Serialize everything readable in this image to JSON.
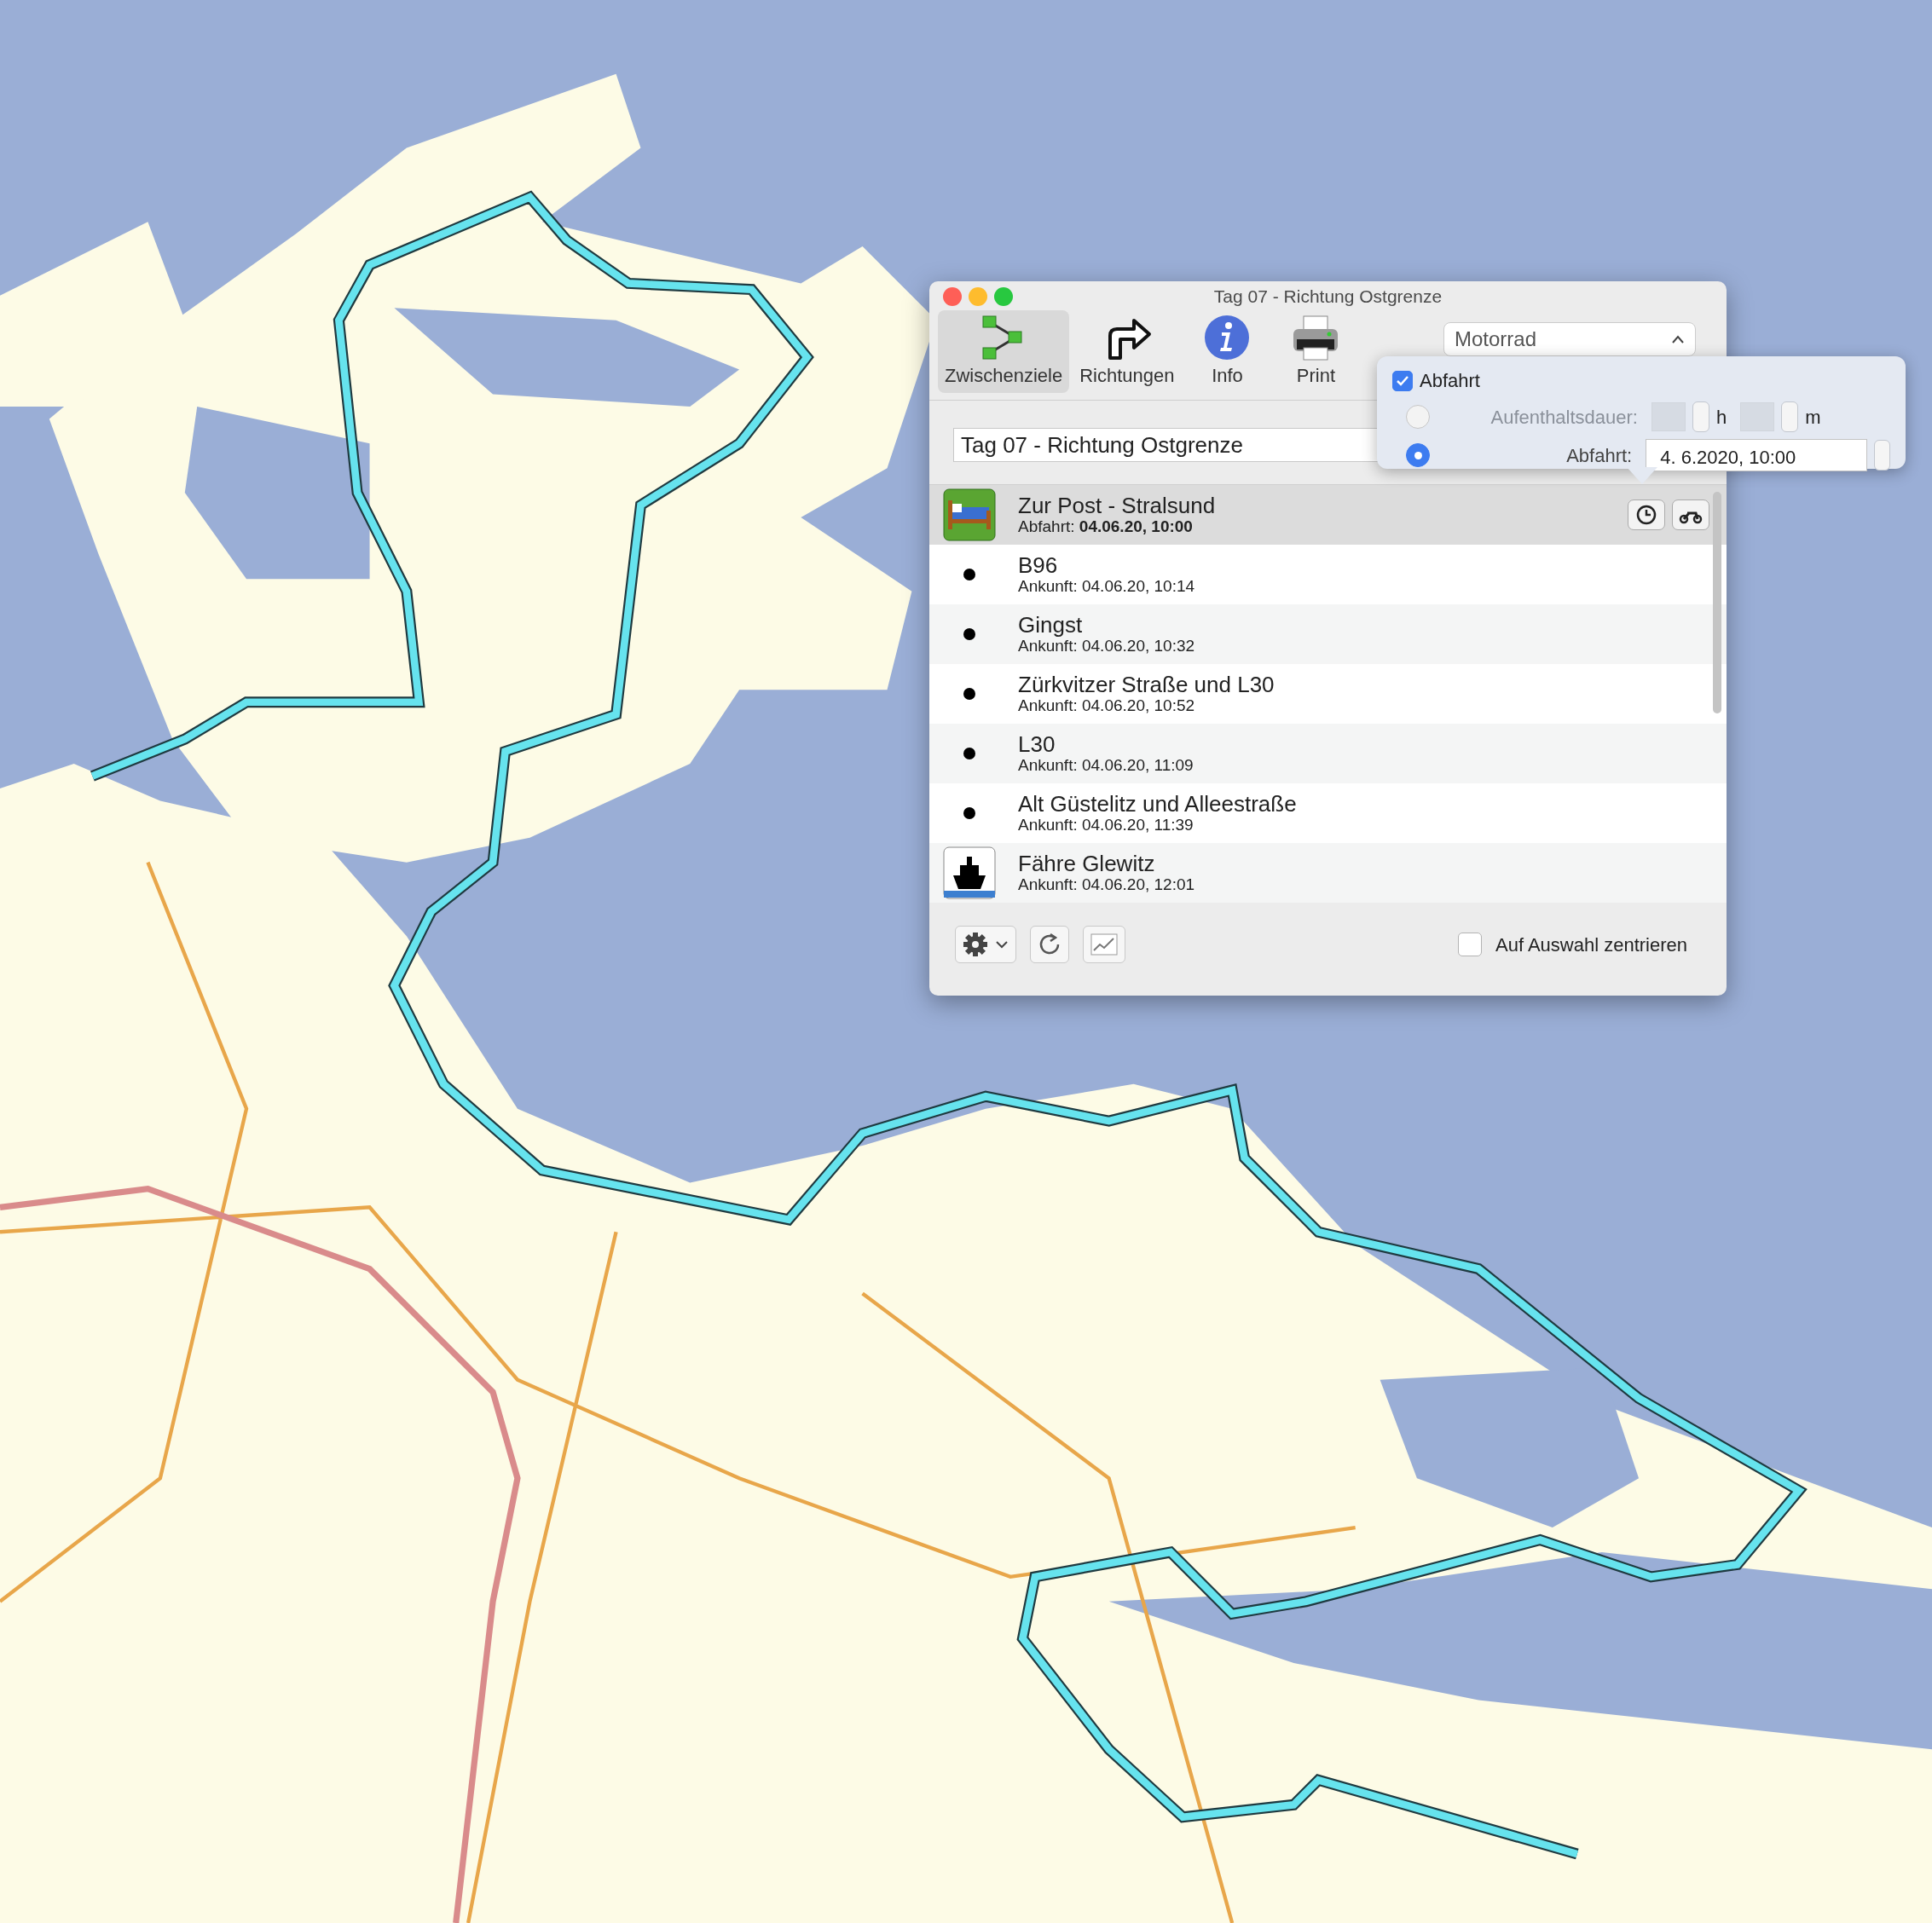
{
  "window": {
    "title": "Tag 07 - Richtung Ostgrenze"
  },
  "toolbar": [
    {
      "label": "Zwischenziele",
      "kind": "waypoints",
      "selected": true
    },
    {
      "label": "Richtungen",
      "kind": "directions",
      "selected": false
    },
    {
      "label": "Info",
      "kind": "info",
      "selected": false
    },
    {
      "label": "Print",
      "kind": "print",
      "selected": false
    }
  ],
  "vehicle_popup": {
    "value": "Motorrad"
  },
  "route_name": {
    "value": "Tag 07 - Richtung Ostgrenze"
  },
  "popover": {
    "departure": {
      "label": "Abfahrt",
      "checked": true
    },
    "options": [
      {
        "kind": "duration",
        "label": "Aufenthaltsdauer:",
        "selected": false,
        "units": [
          "h",
          "m"
        ]
      },
      {
        "kind": "datetime",
        "label": "Abfahrt:",
        "selected": true,
        "value": "4.  6.2020, 10:00"
      }
    ]
  },
  "stops": [
    {
      "kind": "lodging",
      "name": "Zur Post - Stralsund",
      "time": "Abfahrt: **04.06.20, 10:00**",
      "selected": true
    },
    {
      "kind": "via",
      "name": "B96",
      "time": "Ankunft: 04.06.20, 10:14",
      "selected": false
    },
    {
      "kind": "via",
      "name": "Gingst",
      "time": "Ankunft: 04.06.20, 10:32",
      "selected": false
    },
    {
      "kind": "via",
      "name": "Zürkvitzer Straße und L30",
      "time": "Ankunft: 04.06.20, 10:52",
      "selected": false
    },
    {
      "kind": "via",
      "name": "L30",
      "time": "Ankunft: 04.06.20, 11:09",
      "selected": false
    },
    {
      "kind": "via",
      "name": "Alt Güstelitz und Alleestraße",
      "time": "Ankunft: 04.06.20, 11:39",
      "selected": false
    },
    {
      "kind": "ferry",
      "name": "Fähre Glewitz",
      "time": "Ankunft: 04.06.20, 12:01",
      "selected": false
    }
  ],
  "center_on_selection": {
    "label": "Auf Auswahl zentrieren",
    "checked": false
  }
}
